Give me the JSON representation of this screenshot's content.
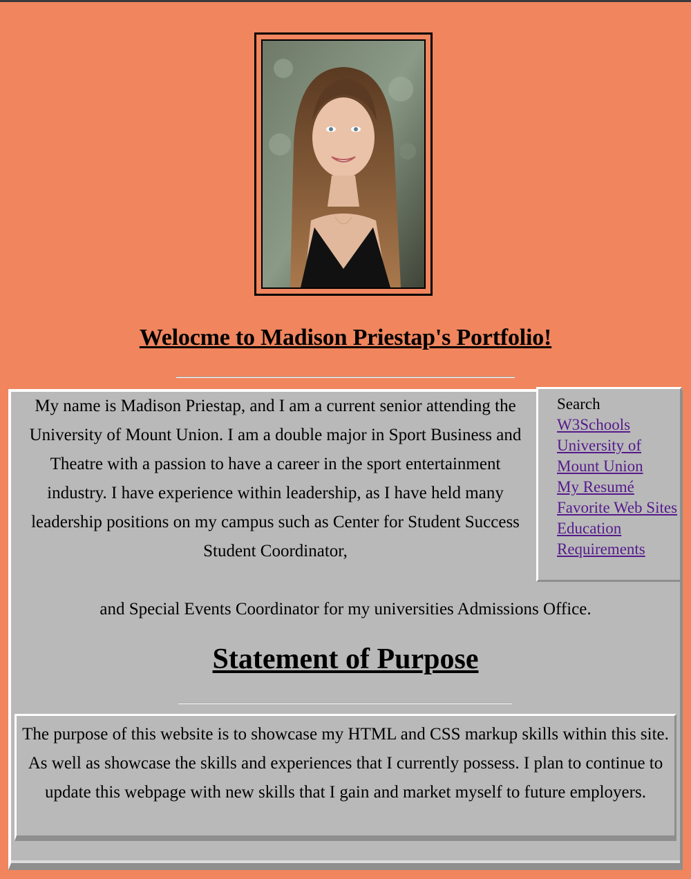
{
  "header": {
    "welcome_title": "Welocme to Madison Priestap's Portfolio!"
  },
  "intro": {
    "paragraph": "My name is Madison Priestap, and I am a current senior attending the University of Mount Union. I am a double major in Sport Business and Theatre with a passion to have a career in the sport entertainment industry. I have experience within leadership, as I have held many leadership positions on my campus such as Center for Student Success Student Coordinator,",
    "tail": "and Special Events Coordinator for my universities Admissions Office."
  },
  "sidebar": {
    "search_label": "Search",
    "links": [
      "W3Schools",
      "University of Mount Union",
      "My Resumé",
      "Favorite Web Sites",
      "Education Requirements"
    ]
  },
  "purpose": {
    "title": "Statement of Purpose",
    "text": "The purpose of this website is to showcase my HTML and CSS markup skills within this site. As well as showcase the skills and experiences that I currently possess. I plan to continue to update this webpage with new skills that I gain and market myself to future employers."
  },
  "colors": {
    "page_background": "#f0855e",
    "panel_background": "#b9b9b9",
    "link": "#551a8b"
  }
}
